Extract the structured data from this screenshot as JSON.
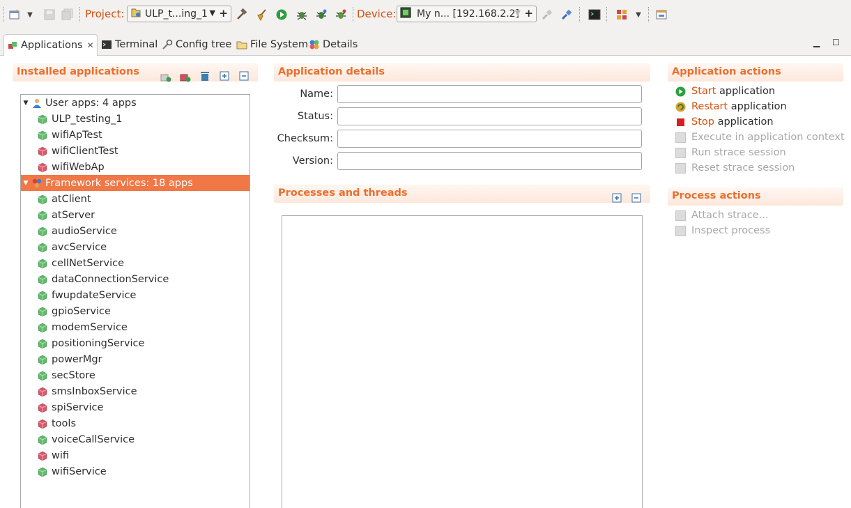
{
  "toolbar": {
    "project_label": "Project:",
    "project_value": "ULP_t...ing_1",
    "device_label": "Device:",
    "device_value": "My n... [192.168.2.2]"
  },
  "tabs": [
    {
      "label": "Applications",
      "icon": "applications-icon",
      "active": true
    },
    {
      "label": "Terminal",
      "icon": "terminal-icon"
    },
    {
      "label": "Config tree",
      "icon": "config-tree-icon"
    },
    {
      "label": "File System",
      "icon": "folder-icon"
    },
    {
      "label": "Details",
      "icon": "details-icon"
    }
  ],
  "installed": {
    "title": "Installed applications",
    "groups": [
      {
        "label": "User apps: 4 apps",
        "apps": [
          {
            "name": "ULP_testing_1",
            "status": "running"
          },
          {
            "name": "wifiApTest",
            "status": "running"
          },
          {
            "name": "wifiClientTest",
            "status": "stopped"
          },
          {
            "name": "wifiWebAp",
            "status": "stopped"
          }
        ]
      },
      {
        "label": "Framework services: 18 apps",
        "selected": true,
        "apps": [
          {
            "name": "atClient",
            "status": "running"
          },
          {
            "name": "atServer",
            "status": "running"
          },
          {
            "name": "audioService",
            "status": "running"
          },
          {
            "name": "avcService",
            "status": "running"
          },
          {
            "name": "cellNetService",
            "status": "running"
          },
          {
            "name": "dataConnectionService",
            "status": "running"
          },
          {
            "name": "fwupdateService",
            "status": "running"
          },
          {
            "name": "gpioService",
            "status": "running"
          },
          {
            "name": "modemService",
            "status": "running"
          },
          {
            "name": "positioningService",
            "status": "running"
          },
          {
            "name": "powerMgr",
            "status": "running"
          },
          {
            "name": "secStore",
            "status": "running"
          },
          {
            "name": "smsInboxService",
            "status": "stopped"
          },
          {
            "name": "spiService",
            "status": "stopped"
          },
          {
            "name": "tools",
            "status": "stopped"
          },
          {
            "name": "voiceCallService",
            "status": "running"
          },
          {
            "name": "wifi",
            "status": "stopped"
          },
          {
            "name": "wifiService",
            "status": "running"
          }
        ]
      }
    ]
  },
  "details": {
    "title": "Application details",
    "fields": [
      {
        "label": "Name:",
        "value": ""
      },
      {
        "label": "Status:",
        "value": ""
      },
      {
        "label": "Checksum:",
        "value": ""
      },
      {
        "label": "Version:",
        "value": ""
      }
    ]
  },
  "processes": {
    "title": "Processes and threads"
  },
  "app_actions": {
    "title": "Application actions",
    "items": [
      {
        "keyword": "Start",
        "rest": " application",
        "enabled": true,
        "icon": "start-icon"
      },
      {
        "keyword": "Restart",
        "rest": " application",
        "enabled": true,
        "icon": "restart-icon"
      },
      {
        "keyword": "Stop",
        "rest": " application",
        "enabled": true,
        "icon": "stop-icon"
      },
      {
        "keyword": "",
        "rest": "Execute in application context",
        "enabled": false,
        "icon": "execute-icon"
      },
      {
        "keyword": "",
        "rest": "Run strace session",
        "enabled": false,
        "icon": "strace-icon"
      },
      {
        "keyword": "",
        "rest": "Reset strace session",
        "enabled": false,
        "icon": "reset-strace-icon"
      }
    ]
  },
  "proc_actions": {
    "title": "Process actions",
    "items": [
      {
        "label": "Attach strace...",
        "enabled": false,
        "icon": "attach-strace-icon"
      },
      {
        "label": "Inspect process",
        "enabled": false,
        "icon": "inspect-icon"
      }
    ]
  },
  "colors": {
    "accent": "#e8702f",
    "selection": "#f07746",
    "app_running": "#5bbf6a",
    "app_stopped": "#e0566a"
  }
}
